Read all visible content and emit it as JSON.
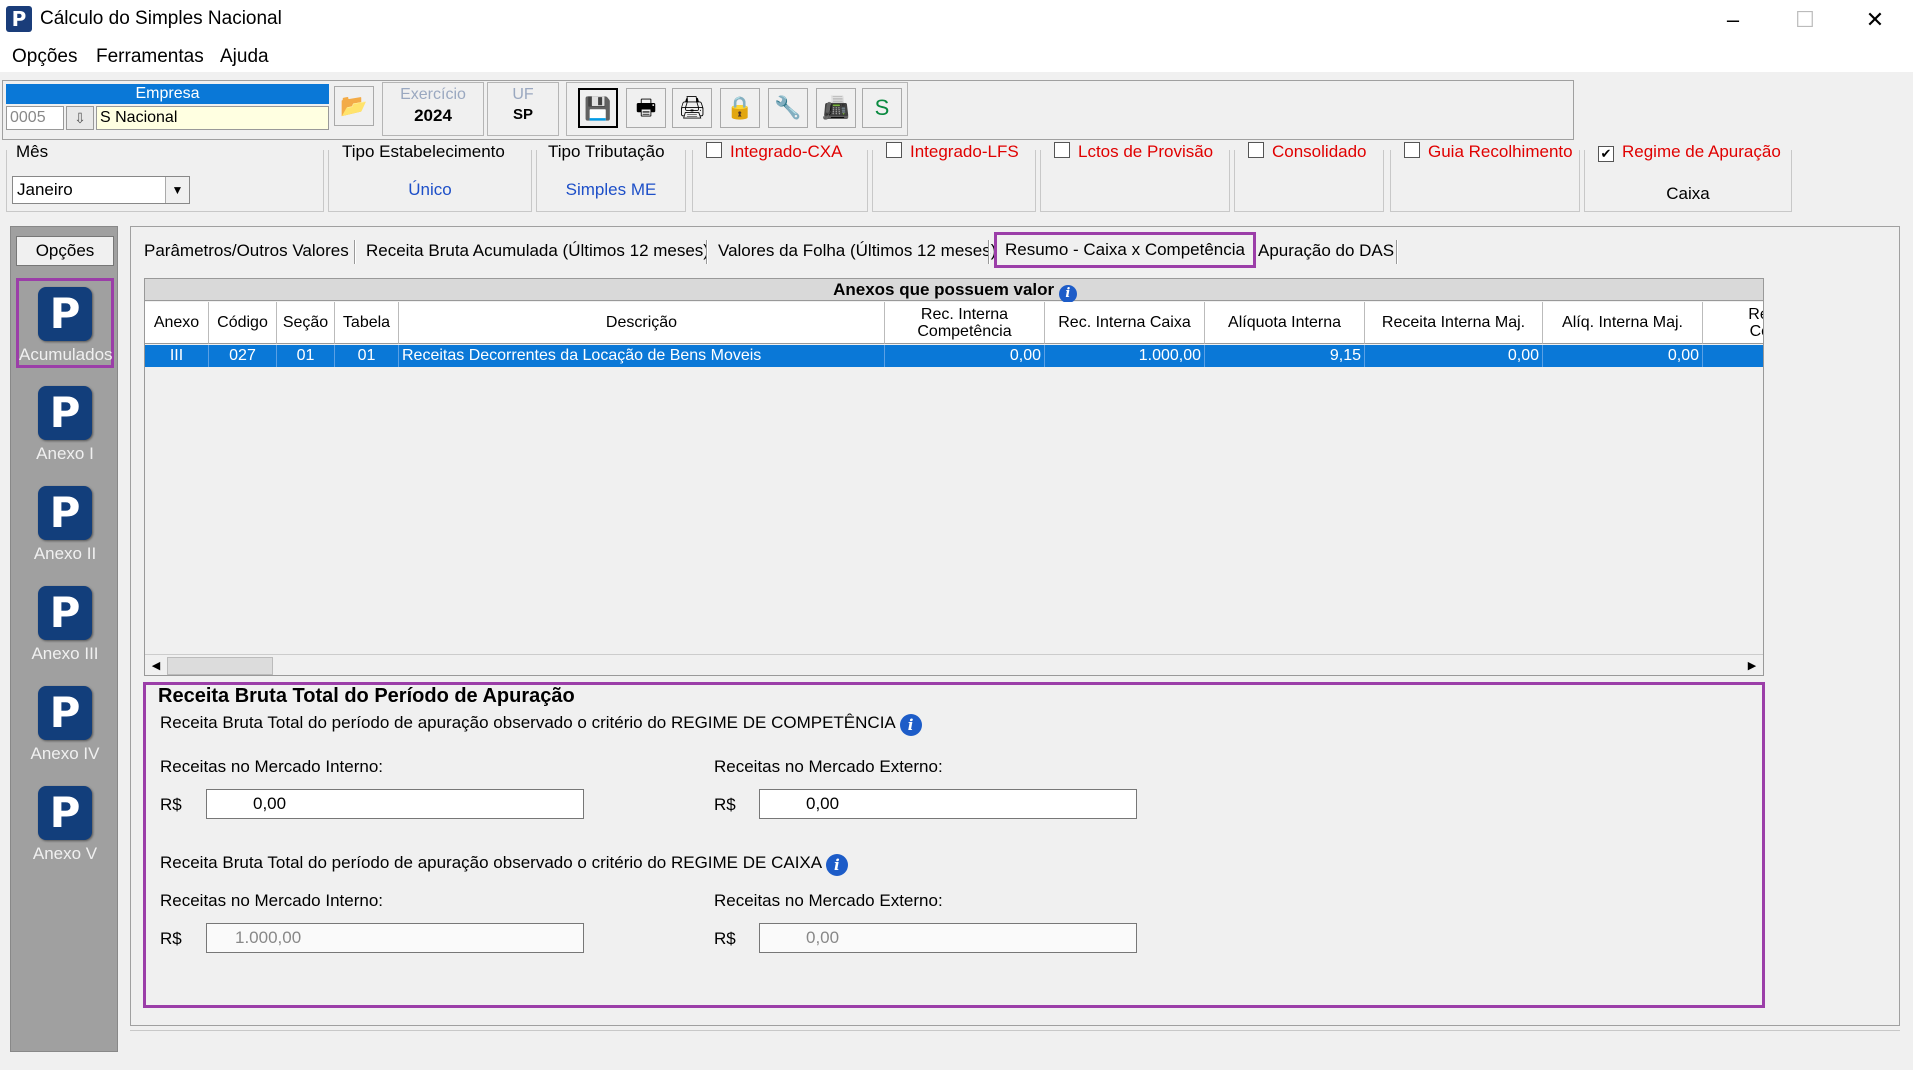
{
  "window": {
    "title": "Cálculo do Simples Nacional",
    "logo": "P",
    "controls": {
      "minimize": "–",
      "maximize": "☐",
      "close": "✕"
    }
  },
  "menu": [
    "Opções",
    "Ferramentas",
    "Ajuda"
  ],
  "toolbar": {
    "empresa_label": "Empresa",
    "empresa_code": "0005",
    "empresa_name": "S Nacional",
    "exercicio_label": "Exercício",
    "exercicio_value": "2024",
    "uf_label": "UF",
    "uf_value": "SP",
    "buttons": [
      "save-icon",
      "print-icon",
      "print-preview-icon",
      "lock-icon",
      "tools-icon",
      "fax-icon",
      "sync-icon"
    ]
  },
  "filters": {
    "mes_label": "Mês",
    "mes_value": "Janeiro",
    "tipo_estabelecimento_label": "Tipo Estabelecimento",
    "tipo_estabelecimento_value": "Único",
    "tipo_tributacao_label": "Tipo Tributação",
    "tipo_tributacao_value": "Simples ME",
    "integrado_cxa": "Integrado-CXA",
    "integrado_lfs": "Integrado-LFS",
    "lctos_provisao": "Lctos de Provisão",
    "consolidado": "Consolidado",
    "guia_recolhimento": "Guia Recolhimento",
    "regime_apuracao_label": "Regime de Apuração",
    "regime_apuracao_value": "Caixa"
  },
  "sidebar": {
    "opcoes": "Opções",
    "items": [
      "Acumulados",
      "Anexo I",
      "Anexo II",
      "Anexo III",
      "Anexo IV",
      "Anexo V"
    ]
  },
  "tabs": [
    "Parâmetros/Outros Valores",
    "Receita Bruta Acumulada (Últimos 12 meses)",
    "Valores da Folha (Últimos 12 meses)",
    "Resumo - Caixa x Competência",
    "Apuração do DAS"
  ],
  "grid": {
    "caption": "Anexos que possuem valor",
    "columns": [
      "Anexo",
      "Código",
      "Seção",
      "Tabela",
      "Descrição",
      "Rec. Interna Competência",
      "Rec. Interna Caixa",
      "Alíquota Interna",
      "Receita Interna Maj.",
      "Alíq. Interna Maj.",
      "Rec Cor"
    ],
    "row": [
      "III",
      "027",
      "01",
      "01",
      "Receitas Decorrentes da Locação de Bens Moveis",
      "0,00",
      "1.000,00",
      "9,15",
      "0,00",
      "0,00",
      ""
    ]
  },
  "receita": {
    "title": "Receita Bruta Total do Período de Apuração",
    "competencia_desc": "Receita Bruta Total do período de apuração observado o critério do REGIME DE COMPETÊNCIA",
    "caixa_desc": "Receita Bruta Total do período de apuração observado o critério do REGIME DE CAIXA",
    "interno_label": "Receitas no Mercado Interno:",
    "externo_label": "Receitas no Mercado Externo:",
    "currency": "R$",
    "comp_interno": "0,00",
    "comp_externo": "0,00",
    "caixa_interno": "1.000,00",
    "caixa_externo": "0,00"
  }
}
